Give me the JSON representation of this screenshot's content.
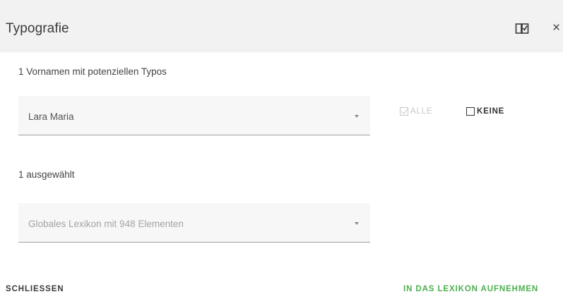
{
  "dialog": {
    "title": "Typografie",
    "subtitle": "1 Vornamen mit potenziellen Typos",
    "name_select": {
      "value": "Lara Maria"
    },
    "select_all_label": "ALLE",
    "select_none_label": "KEINE",
    "selected_count": "1 ausgewählt",
    "lexicon_select": {
      "value": "Globales Lexikon mit 948 Elementen"
    },
    "close_label": "SCHLIESSEN",
    "add_label": "IN DAS LEXIKON AUFNEHMEN"
  },
  "icons": {
    "header_left": "book-check-icon",
    "header_right": "close-icon"
  },
  "colors": {
    "header_bg": "#f2f2f2",
    "accent_green": "#4caf50",
    "disabled_text": "#c7c7c7"
  }
}
